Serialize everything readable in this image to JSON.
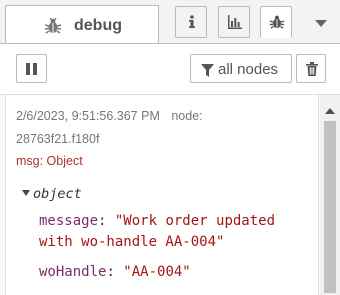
{
  "tabs": {
    "debug_label": "debug",
    "info_icon": "info-icon",
    "dashboard_icon": "bar-chart-icon",
    "debug_icon": "bug-icon",
    "menu_icon": "caret-down-icon"
  },
  "toolbar": {
    "pause_icon": "pause-icon",
    "filter_label": "all nodes",
    "filter_icon": "filter-icon",
    "clear_icon": "trash-icon"
  },
  "message": {
    "timestamp": "2/6/2023, 9:51:56.367 PM",
    "node_label": "node:",
    "node_id": "28763f21.f180f",
    "msg_type": "msg: Object",
    "object_label": "object",
    "properties": [
      {
        "key": "message",
        "value_line1": "\"Work order updated",
        "value_line2": "with wo-handle AA-004\""
      },
      {
        "key": "woHandle",
        "value": "\"AA-004\""
      }
    ]
  },
  "colors": {
    "msg_type": "#aa3333",
    "property_key": "#792e6c",
    "string_value": "#a31515",
    "panel_bg": "#f3f3f3"
  }
}
